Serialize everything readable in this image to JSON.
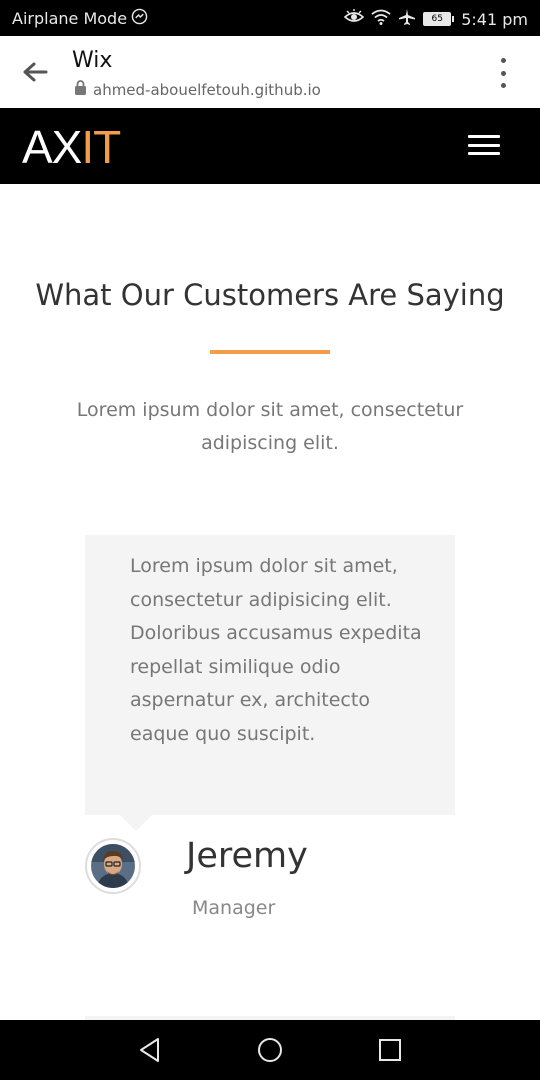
{
  "status_bar": {
    "left_text": "Airplane Mode",
    "battery_level": "65",
    "time": "5:41 pm",
    "icons": [
      "messenger-icon",
      "eye-icon",
      "wifi-icon",
      "airplane-icon",
      "battery-icon"
    ]
  },
  "browser": {
    "title": "Wix",
    "url": "ahmed-abouelfetouh.github.io",
    "icons": [
      "back-arrow-icon",
      "lock-icon",
      "more-vertical-icon"
    ]
  },
  "site": {
    "logo_part1": "AX",
    "logo_part2": "IT",
    "accent_color": "#f39c4a",
    "nav_icon": "hamburger-menu-icon"
  },
  "section": {
    "title": "What Our Customers Are Saying",
    "subtitle": "Lorem ipsum dolor sit amet, consectetur adipiscing elit."
  },
  "testimonial": {
    "text": "Lorem ipsum dolor sit amet, consectetur adipisicing elit. Doloribus accusamus expedita repellat similique odio aspernatur ex, architecto eaque quo suscipit.",
    "name": "Jeremy",
    "role": "Manager"
  },
  "navigation_bar": {
    "icons": [
      "back-triangle-icon",
      "home-circle-icon",
      "recents-square-icon"
    ]
  }
}
